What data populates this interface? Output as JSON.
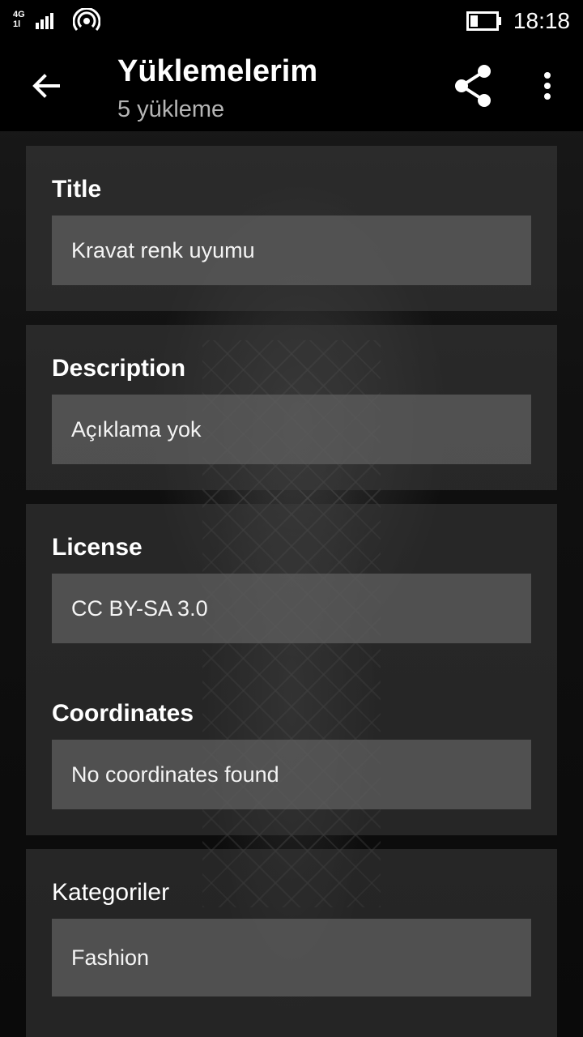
{
  "status_bar": {
    "network": "4G",
    "network_sub": "1l",
    "time": "18:18",
    "icons": [
      "signal-icon",
      "hotspot-icon",
      "battery-icon"
    ]
  },
  "app_bar": {
    "title": "Yüklemelerim",
    "subtitle": "5 yükleme",
    "icons": [
      "back-arrow-icon",
      "share-icon",
      "more-vert-icon"
    ]
  },
  "fields": {
    "title": {
      "label": "Title",
      "value": "Kravat renk uyumu"
    },
    "description": {
      "label": "Description",
      "value": "Açıklama yok"
    },
    "license": {
      "label": "License",
      "value": "CC BY-SA 3.0"
    },
    "coordinates": {
      "label": "Coordinates",
      "value": "No coordinates found"
    },
    "categories": {
      "label": "Kategoriler",
      "value": "Fashion"
    }
  },
  "colors": {
    "background": "#0c0c0c",
    "card": "#3c3c3c",
    "value_box": "#5f5f5f",
    "text": "#ffffff",
    "subtitle": "#b5b5b5"
  }
}
